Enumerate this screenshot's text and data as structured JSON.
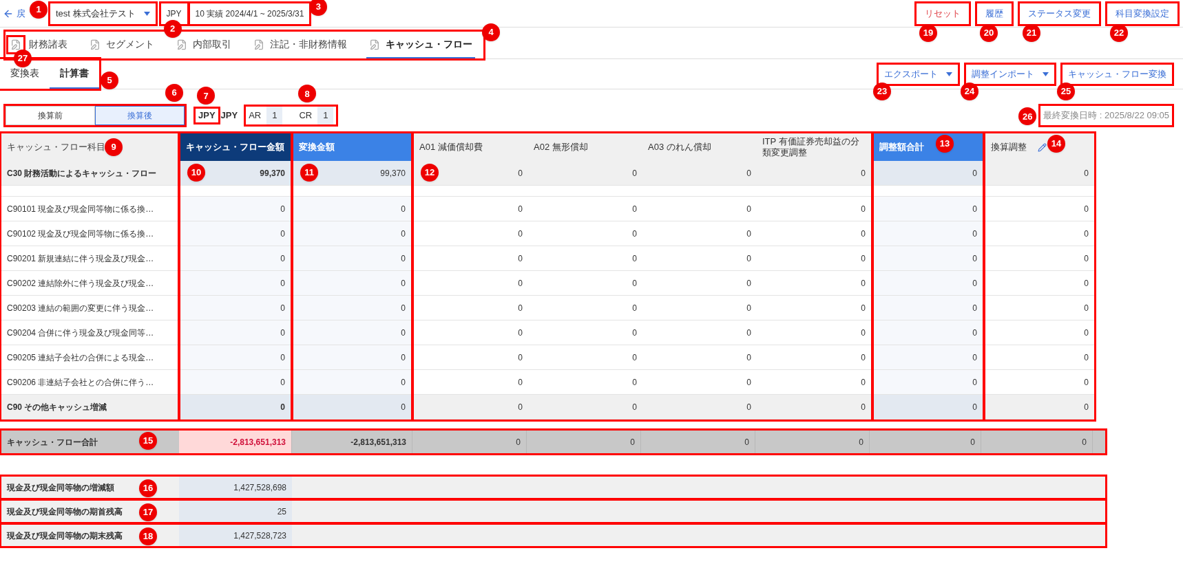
{
  "header": {
    "back_label": "戻",
    "company": {
      "label": "test 株式会社テスト",
      "callout": "1"
    },
    "currency": {
      "label": "JPY",
      "callout": "2"
    },
    "period": {
      "label": "10 実績 2024/4/1 ~ 2025/3/31",
      "callout": "3"
    },
    "buttons": [
      {
        "label": "リセット",
        "kind": "danger",
        "callout": "19"
      },
      {
        "label": "履歴",
        "kind": "normal",
        "callout": "20"
      },
      {
        "label": "ステータス変更",
        "kind": "normal",
        "callout": "21"
      },
      {
        "label": "科目変換設定",
        "kind": "normal",
        "callout": "22"
      }
    ]
  },
  "tabs": {
    "callout": "4",
    "icon_callout": "27",
    "items": [
      {
        "label": "財務諸表",
        "selected": false
      },
      {
        "label": "セグメント",
        "selected": false
      },
      {
        "label": "内部取引",
        "selected": false
      },
      {
        "label": "注記・非財務情報",
        "selected": false
      },
      {
        "label": "キャッシュ・フロー",
        "selected": true
      }
    ]
  },
  "subtabs": {
    "callout": "5",
    "items": [
      {
        "label": "変換表",
        "selected": false
      },
      {
        "label": "計算書",
        "selected": true
      }
    ]
  },
  "actions": [
    {
      "label": "エクスポート",
      "dropdown": true,
      "callout": "23"
    },
    {
      "label": "調整インポート",
      "dropdown": true,
      "callout": "24"
    },
    {
      "label": "キャッシュ・フロー変換",
      "dropdown": false,
      "callout": "25"
    }
  ],
  "toggle": {
    "callout": "6",
    "items": [
      {
        "label": "換算前",
        "selected": false
      },
      {
        "label": "換算後",
        "selected": true
      }
    ]
  },
  "currency_pair": {
    "from": "JPY",
    "from_callout": "7",
    "to": "JPY"
  },
  "rates": {
    "callout": "8",
    "items": [
      {
        "label": "AR",
        "value": "1"
      },
      {
        "label": "CR",
        "value": "1"
      }
    ]
  },
  "last_conversion": {
    "label": "最終変換日時 : 2025/8/22 09:05",
    "callout": "26"
  },
  "table": {
    "groups": [
      {
        "callout": "9",
        "columns": [
          {
            "kind": "label",
            "header": "キャッシュ・フロー科目"
          }
        ]
      },
      {
        "callout": "10",
        "columns": [
          {
            "kind": "primary",
            "header": "キャッシュ・フロー金額"
          }
        ]
      },
      {
        "callout": "11",
        "columns": [
          {
            "kind": "converted",
            "header": "変換金額"
          }
        ]
      },
      {
        "callout": "12",
        "columns": [
          {
            "kind": "plain",
            "header": "A01 減価償却費"
          },
          {
            "kind": "plain",
            "header": "A02 無形償却"
          },
          {
            "kind": "plain",
            "header": "A03 のれん償却"
          },
          {
            "kind": "plain",
            "header": "ITP 有価証券売却益の分類変更調整"
          }
        ]
      },
      {
        "callout": "13",
        "columns": [
          {
            "kind": "total",
            "header": "調整額合計"
          }
        ]
      },
      {
        "callout": "14",
        "columns": [
          {
            "kind": "editable",
            "header": "換算調整"
          }
        ]
      }
    ],
    "rows": [
      {
        "kind": "subtotal",
        "label": "C30 財務活動によるキャッシュ・フロー",
        "values": [
          "99,370",
          "99,370",
          "0",
          "0",
          "0",
          "0",
          "0",
          "0"
        ]
      },
      {
        "kind": "spacer"
      },
      {
        "kind": "item",
        "label": "C90101 現金及び現金同等物に係る換…",
        "values": [
          "0",
          "0",
          "0",
          "0",
          "0",
          "0",
          "0",
          "0"
        ]
      },
      {
        "kind": "item",
        "label": "C90102 現金及び現金同等物に係る換…",
        "values": [
          "0",
          "0",
          "0",
          "0",
          "0",
          "0",
          "0",
          "0"
        ]
      },
      {
        "kind": "item",
        "label": "C90201 新規連結に伴う現金及び現金…",
        "values": [
          "0",
          "0",
          "0",
          "0",
          "0",
          "0",
          "0",
          "0"
        ]
      },
      {
        "kind": "item",
        "label": "C90202 連結除外に伴う現金及び現金…",
        "values": [
          "0",
          "0",
          "0",
          "0",
          "0",
          "0",
          "0",
          "0"
        ]
      },
      {
        "kind": "item",
        "label": "C90203 連結の範囲の変更に伴う現金…",
        "values": [
          "0",
          "0",
          "0",
          "0",
          "0",
          "0",
          "0",
          "0"
        ]
      },
      {
        "kind": "item",
        "label": "C90204 合併に伴う現金及び現金同等…",
        "values": [
          "0",
          "0",
          "0",
          "0",
          "0",
          "0",
          "0",
          "0"
        ]
      },
      {
        "kind": "item",
        "label": "C90205 連結子会社の合併による現金…",
        "values": [
          "0",
          "0",
          "0",
          "0",
          "0",
          "0",
          "0",
          "0"
        ]
      },
      {
        "kind": "item",
        "label": "C90206 非連結子会社との合併に伴う…",
        "values": [
          "0",
          "0",
          "0",
          "0",
          "0",
          "0",
          "0",
          "0"
        ]
      },
      {
        "kind": "subtotal",
        "label": "C90 その他キャッシュ増減",
        "values": [
          "0",
          "0",
          "0",
          "0",
          "0",
          "0",
          "0",
          "0"
        ]
      }
    ]
  },
  "total_row": {
    "callout": "15",
    "label": "キャッシュ・フロー合計",
    "values": [
      "-2,813,651,313",
      "-2,813,651,313",
      "0",
      "0",
      "0",
      "0",
      "0",
      "0"
    ]
  },
  "summary_rows": [
    {
      "callout": "16",
      "label": "現金及び現金同等物の増減額",
      "value": "1,427,528,698"
    },
    {
      "callout": "17",
      "label": "現金及び現金同等物の期首残高",
      "value": "25"
    },
    {
      "callout": "18",
      "label": "現金及び現金同等物の期末残高",
      "value": "1,427,528,723"
    }
  ]
}
